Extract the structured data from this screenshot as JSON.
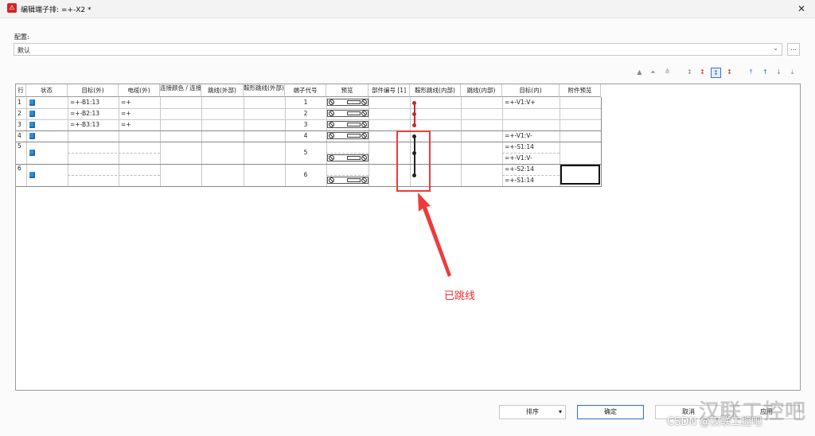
{
  "window": {
    "title": "编辑端子排: =+-X2 *",
    "close_glyph": "✕"
  },
  "config": {
    "label": "配置:",
    "value": "默认",
    "more_label": "..."
  },
  "columns": [
    "行",
    "状态",
    "目标(外)",
    "电缆(外)",
    "连接颜色 / 连接编号",
    "跳线(外部)",
    "鞍形跳线(外部)",
    "端子代号",
    "预览",
    "部件编号 [1]",
    "鞍形跳线(内部)",
    "跳线(内部)",
    "目标(内)",
    "附件预览"
  ],
  "rows": [
    {
      "row": "1",
      "target_out": "=+-B1:13",
      "cable_out": "=+",
      "terminal": "1",
      "target_in": [
        "=+-V1:V+"
      ]
    },
    {
      "row": "2",
      "target_out": "=+-B2:13",
      "cable_out": "=+",
      "terminal": "2",
      "target_in": []
    },
    {
      "row": "3",
      "target_out": "=+-B3:13",
      "cable_out": "=+",
      "terminal": "3",
      "target_in": []
    },
    {
      "row": "4",
      "target_out": "",
      "cable_out": "",
      "terminal": "4",
      "target_in": [
        "=+-V1:V-"
      ]
    },
    {
      "row": "5",
      "target_out": "",
      "cable_out": "",
      "terminal": "5",
      "target_in": [
        "=+-S1:14",
        "=+-V1:V-"
      ]
    },
    {
      "row": "6",
      "target_out": "",
      "cable_out": "",
      "terminal": "6",
      "target_in": [
        "=+-S2:14",
        "=+-S1:14"
      ]
    }
  ],
  "buttons": {
    "sort": "排序",
    "sort_arrow": "▾",
    "ok": "确定",
    "cancel": "取消",
    "apply": "应用"
  },
  "annotation": {
    "label": "已跳线",
    "color": "#ee3030"
  },
  "watermark": {
    "csdn": "CSDN @汉联工控吧",
    "logo": "汉联工控吧"
  },
  "colors": {
    "jumper_red": "#c62828",
    "jumper_black": "#222222",
    "status_blue": "#2f8fd8",
    "selected_tool": "#3a6fd8"
  }
}
